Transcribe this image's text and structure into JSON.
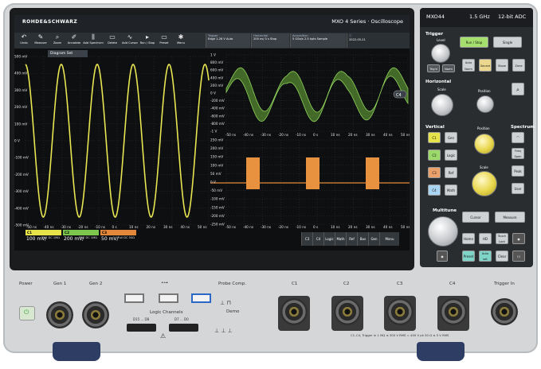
{
  "header": {
    "brand": "ROHDE&SCHWARZ",
    "model_line": "MXO 4 Series · Oscilloscope"
  },
  "toolbar": {
    "buttons": [
      "Undo",
      "Measure",
      "Zoom",
      "Annotate",
      "Add Spectrum",
      "Delete",
      "Add Cursor",
      "Run / Stop",
      "Preset",
      "Menu"
    ],
    "trigger": {
      "title": "Trigger",
      "line1": "Edge",
      "line2": "1.26 V",
      "line3": "Auto"
    },
    "horizontal": {
      "title": "Horizontal",
      "line1": "200 ns/",
      "line2": "0 s",
      "line3": "Stop"
    },
    "acquisition": {
      "title": "Acquisition",
      "line1": "5 GSa/s",
      "line2": "2.5 kpts",
      "line3": "Sample"
    },
    "date": "2022-05-21"
  },
  "left_graph": {
    "diagram_label": "Diagram Set",
    "y_ticks": [
      "500 mV",
      "400 mV",
      "300 mV",
      "200 mV",
      "100 mV",
      "0 V",
      "-100 mV",
      "-200 mV",
      "-300 mV",
      "-400 mV",
      "-500 mV"
    ],
    "x_ticks": [
      "-50 ns",
      "-40 ns",
      "-30 ns",
      "-20 ns",
      "-10 ns",
      "0 s",
      "10 ns",
      "20 ns",
      "30 ns",
      "40 ns",
      "50 ns"
    ]
  },
  "right_top": {
    "y_ticks": [
      "1 V",
      "800 mV",
      "600 mV",
      "400 mV",
      "200 mV",
      "0 V",
      "-200 mV",
      "-400 mV",
      "-600 mV",
      "-800 mV",
      "-1 V"
    ],
    "x_ticks": [
      "-50 ns",
      "-40 ns",
      "-30 ns",
      "-20 ns",
      "-10 ns",
      "0 s",
      "10 ns",
      "20 ns",
      "30 ns",
      "40 ns",
      "50 ns"
    ],
    "marker": "C4"
  },
  "right_bottom": {
    "y_ticks": [
      "250 mV",
      "200 mV",
      "150 mV",
      "100 mV",
      "50 mV",
      "0 V",
      "-50 mV",
      "-100 mV",
      "-150 mV",
      "-200 mV",
      "-250 mV"
    ],
    "x_ticks": [
      "-50 ns",
      "-40 ns",
      "-30 ns",
      "-20 ns",
      "-10 ns",
      "0 s",
      "10 ns",
      "20 ns",
      "30 ns",
      "40 ns",
      "50 ns"
    ]
  },
  "channels": [
    {
      "tag": "C1",
      "value": "100 mV/",
      "sub": "Full DC 1MΩ",
      "color": "#e6e24a"
    },
    {
      "tag": "C2",
      "value": "200 mV/",
      "sub": "Full DC 1MΩ",
      "color": "#7dc64d"
    },
    {
      "tag": "C3",
      "value": "50 mV/",
      "sub": "Full DC 50Ω",
      "color": "#e3883a"
    }
  ],
  "bottom_buttons": [
    "C3",
    "C4",
    "Logic",
    "Math",
    "Ref",
    "Bus",
    "Gen",
    "Menu"
  ],
  "panel": {
    "title_left": "MXO44",
    "title_mid": "1.5 GHz",
    "title_right": "12-bit ADC",
    "trigger": {
      "title": "Trigger",
      "level": "Level",
      "run": "Run / Stop",
      "single": "Single",
      "trig": "Trig'd",
      "auto": "Auto Norm",
      "source": "Source",
      "slope": "Slope",
      "zone": "Zone"
    },
    "horizontal": {
      "title": "Horizontal",
      "scale": "Scale",
      "position": "Position"
    },
    "vertical": {
      "title": "Vertical",
      "spectrum": "Spectrum",
      "position": "Position",
      "scale": "Scale",
      "chs": [
        "C1",
        "C2",
        "C3",
        "C4"
      ],
      "keys": [
        "Gen",
        "Logic",
        "Ref",
        "Math"
      ],
      "spec_keys": [
        "Freq Span",
        "Peak",
        "User"
      ]
    },
    "multi": {
      "title": "Multitune",
      "cursor": "Cursor",
      "measure": "Measure",
      "home": "Home",
      "hd": "HD",
      "lock": "Touch Lock",
      "preset": "Preset",
      "autoset": "Auto set",
      "clear": "Clear"
    }
  },
  "front": {
    "power": "Power",
    "gen1": "Gen 1",
    "gen2": "Gen 2",
    "usb": "•⊶",
    "probe": "Probe Comp.",
    "logic": "Logic Channels",
    "logic_a": "D15 ... D8",
    "logic_b": "D7 ... D0",
    "demo": "Demo",
    "c1": "C1",
    "c2": "C2",
    "c3": "C3",
    "c4": "C4",
    "trig_in": "Trigger In",
    "warning": "C1–C4, Trigger In 1 MΩ ≤ 300 V RMS = 400 V pk 50 Ω ≤ 5 V RMS"
  }
}
